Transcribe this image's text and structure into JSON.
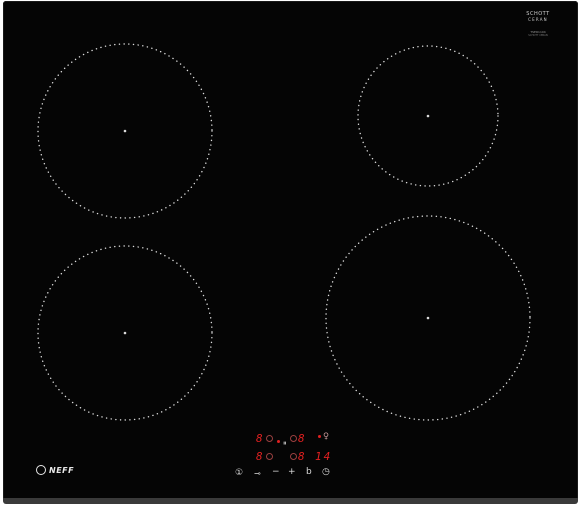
{
  "appliance": {
    "brand": "NEFF",
    "glass_logo_line1": "SCHOTT",
    "glass_logo_line2": "CERAN",
    "glass_logo_line3": "TSER1104",
    "glass_logo_line4": "SCHOTT CERAN"
  },
  "zones": [
    {
      "id": "top-left",
      "label": ""
    },
    {
      "id": "top-right",
      "label": ""
    },
    {
      "id": "bottom-left",
      "label": ""
    },
    {
      "id": "bottom-right",
      "label": ""
    }
  ],
  "display": {
    "row1_left": "8",
    "row1_mid": "8",
    "row1_right": "8",
    "row2_left": "8",
    "row2_mid": "8",
    "row2_right": "14",
    "pause_symbol": "⏸",
    "alarm_symbol": "♀"
  },
  "controls": {
    "power": "①",
    "lock": "⊸",
    "minus": "−",
    "plus": "+",
    "boost": "b",
    "timer": "◷"
  },
  "colors": {
    "glass": "#050505",
    "display_red": "#e02020",
    "zone_dots": "#dcdcdc",
    "controls": "#d8d8d8"
  }
}
